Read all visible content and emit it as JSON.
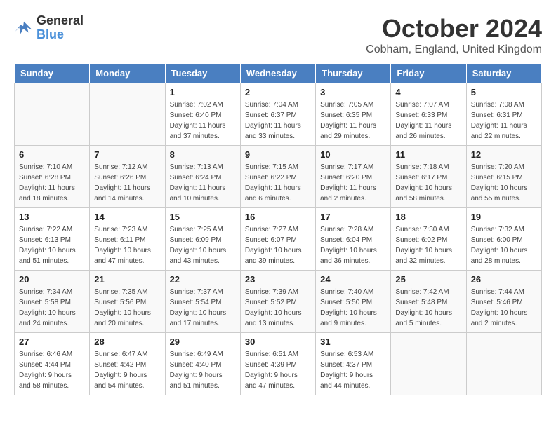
{
  "header": {
    "logo_line1": "General",
    "logo_line2": "Blue",
    "month": "October 2024",
    "location": "Cobham, England, United Kingdom"
  },
  "weekdays": [
    "Sunday",
    "Monday",
    "Tuesday",
    "Wednesday",
    "Thursday",
    "Friday",
    "Saturday"
  ],
  "weeks": [
    [
      {
        "day": "",
        "info": ""
      },
      {
        "day": "",
        "info": ""
      },
      {
        "day": "1",
        "info": "Sunrise: 7:02 AM\nSunset: 6:40 PM\nDaylight: 11 hours and 37 minutes."
      },
      {
        "day": "2",
        "info": "Sunrise: 7:04 AM\nSunset: 6:37 PM\nDaylight: 11 hours and 33 minutes."
      },
      {
        "day": "3",
        "info": "Sunrise: 7:05 AM\nSunset: 6:35 PM\nDaylight: 11 hours and 29 minutes."
      },
      {
        "day": "4",
        "info": "Sunrise: 7:07 AM\nSunset: 6:33 PM\nDaylight: 11 hours and 26 minutes."
      },
      {
        "day": "5",
        "info": "Sunrise: 7:08 AM\nSunset: 6:31 PM\nDaylight: 11 hours and 22 minutes."
      }
    ],
    [
      {
        "day": "6",
        "info": "Sunrise: 7:10 AM\nSunset: 6:28 PM\nDaylight: 11 hours and 18 minutes."
      },
      {
        "day": "7",
        "info": "Sunrise: 7:12 AM\nSunset: 6:26 PM\nDaylight: 11 hours and 14 minutes."
      },
      {
        "day": "8",
        "info": "Sunrise: 7:13 AM\nSunset: 6:24 PM\nDaylight: 11 hours and 10 minutes."
      },
      {
        "day": "9",
        "info": "Sunrise: 7:15 AM\nSunset: 6:22 PM\nDaylight: 11 hours and 6 minutes."
      },
      {
        "day": "10",
        "info": "Sunrise: 7:17 AM\nSunset: 6:20 PM\nDaylight: 11 hours and 2 minutes."
      },
      {
        "day": "11",
        "info": "Sunrise: 7:18 AM\nSunset: 6:17 PM\nDaylight: 10 hours and 58 minutes."
      },
      {
        "day": "12",
        "info": "Sunrise: 7:20 AM\nSunset: 6:15 PM\nDaylight: 10 hours and 55 minutes."
      }
    ],
    [
      {
        "day": "13",
        "info": "Sunrise: 7:22 AM\nSunset: 6:13 PM\nDaylight: 10 hours and 51 minutes."
      },
      {
        "day": "14",
        "info": "Sunrise: 7:23 AM\nSunset: 6:11 PM\nDaylight: 10 hours and 47 minutes."
      },
      {
        "day": "15",
        "info": "Sunrise: 7:25 AM\nSunset: 6:09 PM\nDaylight: 10 hours and 43 minutes."
      },
      {
        "day": "16",
        "info": "Sunrise: 7:27 AM\nSunset: 6:07 PM\nDaylight: 10 hours and 39 minutes."
      },
      {
        "day": "17",
        "info": "Sunrise: 7:28 AM\nSunset: 6:04 PM\nDaylight: 10 hours and 36 minutes."
      },
      {
        "day": "18",
        "info": "Sunrise: 7:30 AM\nSunset: 6:02 PM\nDaylight: 10 hours and 32 minutes."
      },
      {
        "day": "19",
        "info": "Sunrise: 7:32 AM\nSunset: 6:00 PM\nDaylight: 10 hours and 28 minutes."
      }
    ],
    [
      {
        "day": "20",
        "info": "Sunrise: 7:34 AM\nSunset: 5:58 PM\nDaylight: 10 hours and 24 minutes."
      },
      {
        "day": "21",
        "info": "Sunrise: 7:35 AM\nSunset: 5:56 PM\nDaylight: 10 hours and 20 minutes."
      },
      {
        "day": "22",
        "info": "Sunrise: 7:37 AM\nSunset: 5:54 PM\nDaylight: 10 hours and 17 minutes."
      },
      {
        "day": "23",
        "info": "Sunrise: 7:39 AM\nSunset: 5:52 PM\nDaylight: 10 hours and 13 minutes."
      },
      {
        "day": "24",
        "info": "Sunrise: 7:40 AM\nSunset: 5:50 PM\nDaylight: 10 hours and 9 minutes."
      },
      {
        "day": "25",
        "info": "Sunrise: 7:42 AM\nSunset: 5:48 PM\nDaylight: 10 hours and 5 minutes."
      },
      {
        "day": "26",
        "info": "Sunrise: 7:44 AM\nSunset: 5:46 PM\nDaylight: 10 hours and 2 minutes."
      }
    ],
    [
      {
        "day": "27",
        "info": "Sunrise: 6:46 AM\nSunset: 4:44 PM\nDaylight: 9 hours and 58 minutes."
      },
      {
        "day": "28",
        "info": "Sunrise: 6:47 AM\nSunset: 4:42 PM\nDaylight: 9 hours and 54 minutes."
      },
      {
        "day": "29",
        "info": "Sunrise: 6:49 AM\nSunset: 4:40 PM\nDaylight: 9 hours and 51 minutes."
      },
      {
        "day": "30",
        "info": "Sunrise: 6:51 AM\nSunset: 4:39 PM\nDaylight: 9 hours and 47 minutes."
      },
      {
        "day": "31",
        "info": "Sunrise: 6:53 AM\nSunset: 4:37 PM\nDaylight: 9 hours and 44 minutes."
      },
      {
        "day": "",
        "info": ""
      },
      {
        "day": "",
        "info": ""
      }
    ]
  ]
}
